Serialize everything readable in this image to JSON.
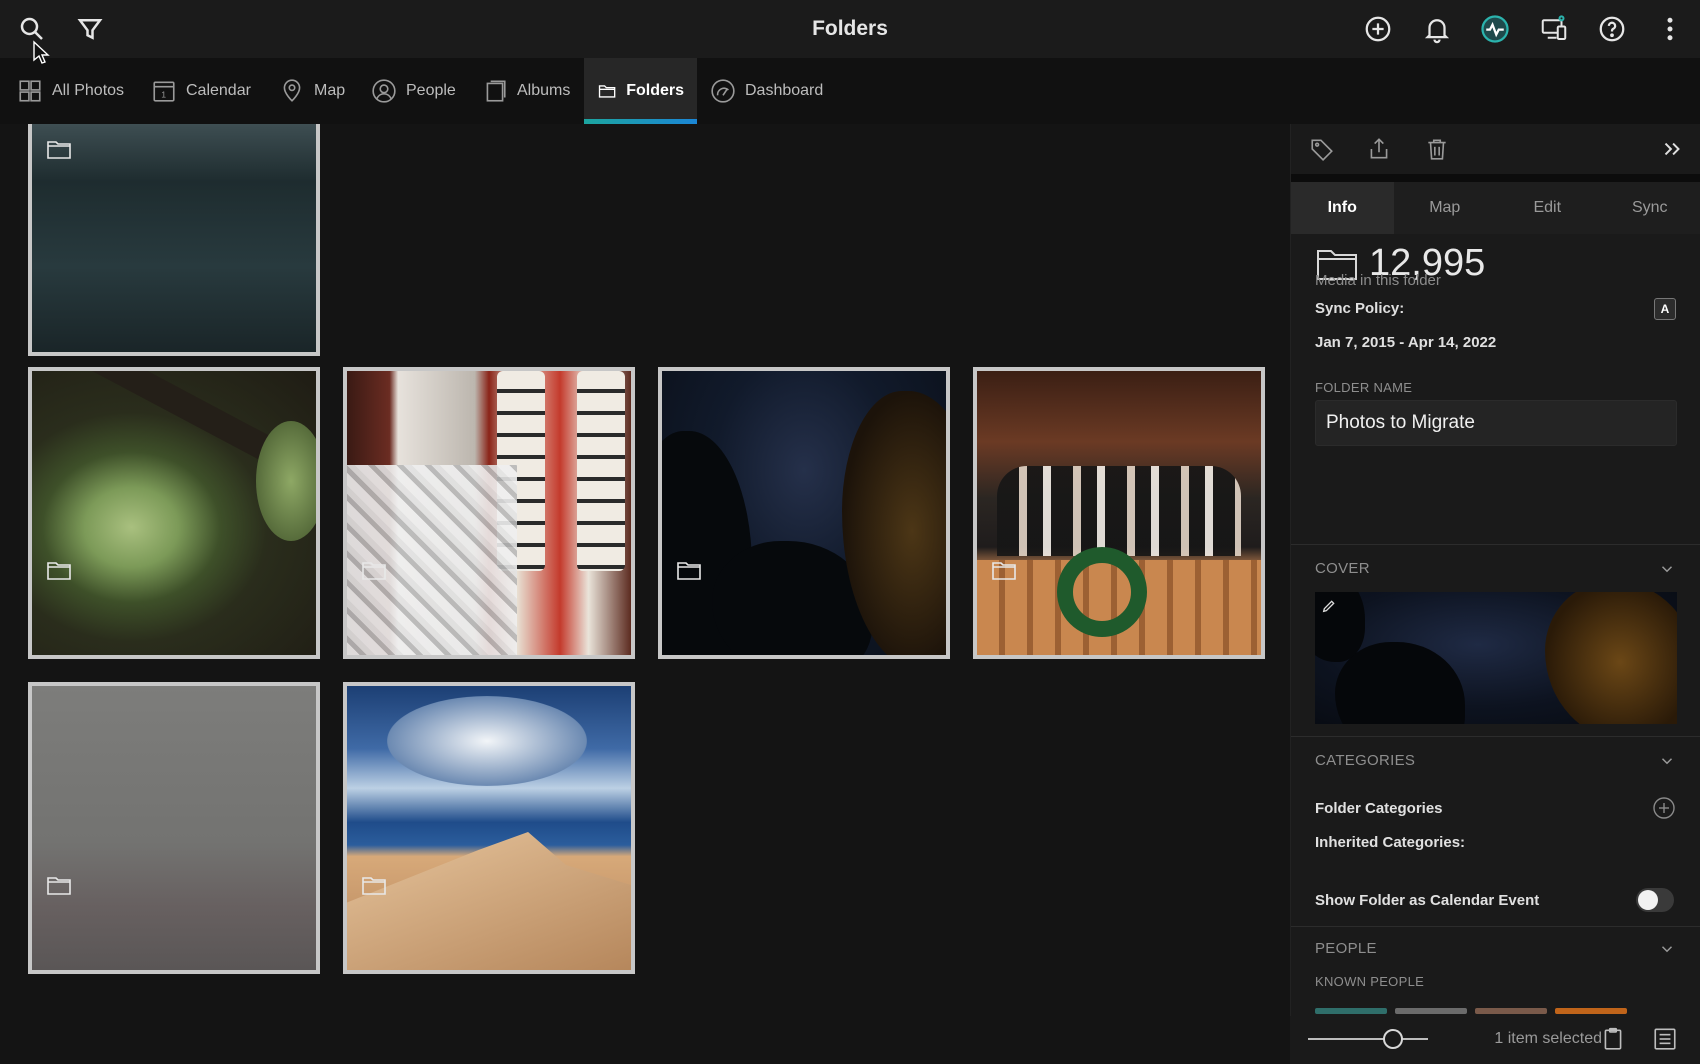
{
  "app": {
    "title": "Folders"
  },
  "topbar": {
    "left_icons": [
      "search-icon",
      "filter-icon"
    ],
    "right_icons": [
      "add-circle-icon",
      "bell-icon",
      "activity-icon",
      "devices-icon",
      "help-icon",
      "more-vertical-icon"
    ],
    "accent_color": "#1ca59f"
  },
  "nav": {
    "tabs": [
      {
        "label": "All Photos",
        "icon": "grid-icon"
      },
      {
        "label": "Calendar",
        "icon": "calendar-icon"
      },
      {
        "label": "Map",
        "icon": "map-pin-icon"
      },
      {
        "label": "People",
        "icon": "person-icon"
      },
      {
        "label": "Albums",
        "icon": "album-icon"
      },
      {
        "label": "Folders",
        "icon": "folder-icon",
        "active": true
      },
      {
        "label": "Dashboard",
        "icon": "dashboard-icon"
      }
    ]
  },
  "grid": {
    "items": [
      {
        "name": "harbor-water-folder"
      },
      {
        "name": "green-pod-folder"
      },
      {
        "name": "shrine-lanterns-folder"
      },
      {
        "name": "night-sky-folder",
        "selected": true
      },
      {
        "name": "wedding-group-folder"
      },
      {
        "name": "gray-wall-folder"
      },
      {
        "name": "rock-sky-folder"
      }
    ]
  },
  "panel": {
    "toolbar_icons": [
      "tag-icon",
      "share-icon",
      "trash-icon",
      "collapse-panel-icon"
    ],
    "tabs": [
      {
        "label": "Info",
        "active": true
      },
      {
        "label": "Map"
      },
      {
        "label": "Edit"
      },
      {
        "label": "Sync"
      }
    ],
    "media_count": "12,995",
    "media_caption": "Media in this folder",
    "sync_policy_label": "Sync Policy:",
    "sync_policy_badge": "A",
    "date_range": "Jan 7, 2015 - Apr 14, 2022",
    "folder_name_label": "FOLDER NAME",
    "folder_name_value": "Photos to Migrate",
    "cover_label": "COVER",
    "categories_label": "CATEGORIES",
    "folder_categories_label": "Folder Categories",
    "inherited_categories_label": "Inherited Categories:",
    "show_calendar_label": "Show Folder as Calendar Event",
    "show_calendar_on": false,
    "people_label": "PEOPLE",
    "known_people_label": "KNOWN PEOPLE"
  },
  "bottom_bar": {
    "zoom_level_fraction": 0.75,
    "selection_text": "1 item selected"
  }
}
